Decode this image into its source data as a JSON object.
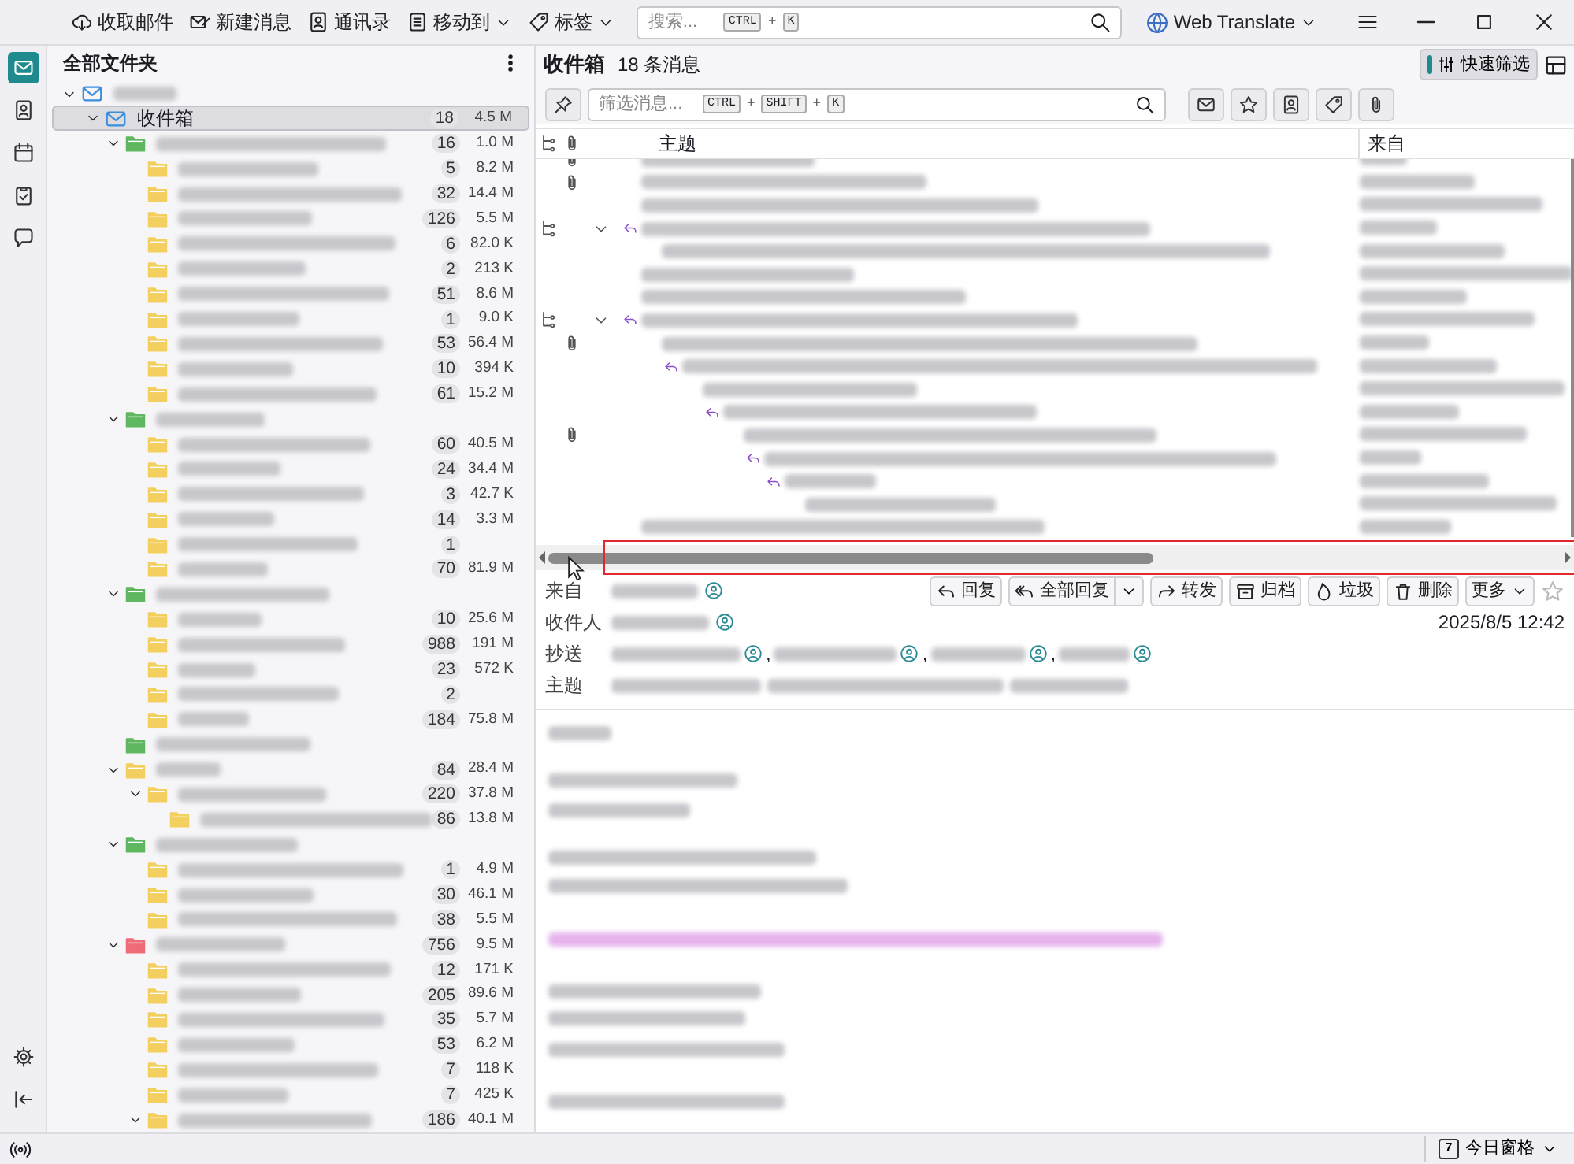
{
  "spaces": [
    {
      "kind": "mail",
      "selected": true
    },
    {
      "kind": "addressbook",
      "selected": false
    },
    {
      "kind": "calendar",
      "selected": false
    },
    {
      "kind": "tasks",
      "selected": false
    },
    {
      "kind": "chat",
      "selected": false
    }
  ],
  "spaces_bottom": [
    {
      "kind": "settings"
    },
    {
      "kind": "collapse"
    }
  ],
  "toolbar": [
    {
      "kind": "getmail",
      "label": "收取邮件",
      "dropdown": false
    },
    {
      "kind": "compose",
      "label": "新建消息",
      "dropdown": false
    },
    {
      "kind": "addressbook",
      "label": "通讯录",
      "dropdown": false
    },
    {
      "kind": "moveto",
      "label": "移动到",
      "dropdown": true
    },
    {
      "kind": "tag",
      "label": "标签",
      "dropdown": true
    }
  ],
  "search": {
    "placeholder": "搜索...",
    "shortcut": [
      {
        "key": "CTRL"
      },
      {
        "sep": "+"
      },
      {
        "key": "K"
      }
    ]
  },
  "translate": {
    "label": "Web Translate"
  },
  "folder_pane": {
    "title": "全部文件夹"
  },
  "folders": [
    {
      "kind": "account",
      "expanded": true,
      "selected": false,
      "children": [
        {
          "kind": "inbox",
          "label": "收件箱",
          "expanded": true,
          "selected": true,
          "unread": "18",
          "size": "4.5 M",
          "children": [
            {
              "kind": "folder",
              "color": "#5fb760",
              "expanded": true,
              "selected": false,
              "unread": "16",
              "size": "1.0 M",
              "children": [
                {
                  "kind": "folder",
                  "color": "#f3cf5f",
                  "selected": false,
                  "unread": "5",
                  "size": "8.2 M"
                },
                {
                  "kind": "folder",
                  "color": "#f3cf5f",
                  "selected": false,
                  "unread": "32",
                  "size": "14.4 M"
                },
                {
                  "kind": "folder",
                  "color": "#f3cf5f",
                  "selected": false,
                  "unread": "126",
                  "size": "5.5 M"
                },
                {
                  "kind": "folder",
                  "color": "#f3cf5f",
                  "selected": false,
                  "unread": "6",
                  "size": "82.0 K"
                },
                {
                  "kind": "folder",
                  "color": "#f3cf5f",
                  "selected": false,
                  "unread": "2",
                  "size": "213 K"
                },
                {
                  "kind": "folder",
                  "color": "#f3cf5f",
                  "selected": false,
                  "unread": "51",
                  "size": "8.6 M"
                },
                {
                  "kind": "folder",
                  "color": "#f3cf5f",
                  "selected": false,
                  "unread": "1",
                  "size": "9.0 K"
                },
                {
                  "kind": "folder",
                  "color": "#f3cf5f",
                  "selected": false,
                  "unread": "53",
                  "size": "56.4 M"
                },
                {
                  "kind": "folder",
                  "color": "#f3cf5f",
                  "selected": false,
                  "unread": "10",
                  "size": "394 K"
                },
                {
                  "kind": "folder",
                  "color": "#f3cf5f",
                  "selected": false,
                  "unread": "61",
                  "size": "15.2 M"
                }
              ]
            },
            {
              "kind": "folder",
              "color": "#5fb760",
              "expanded": true,
              "selected": false,
              "children": [
                {
                  "kind": "folder",
                  "color": "#f3cf5f",
                  "selected": false,
                  "unread": "60",
                  "size": "40.5 M"
                },
                {
                  "kind": "folder",
                  "color": "#f3cf5f",
                  "selected": false,
                  "unread": "24",
                  "size": "34.4 M"
                },
                {
                  "kind": "folder",
                  "color": "#f3cf5f",
                  "selected": false,
                  "unread": "3",
                  "size": "42.7 K"
                },
                {
                  "kind": "folder",
                  "color": "#f3cf5f",
                  "selected": false,
                  "unread": "14",
                  "size": "3.3 M"
                },
                {
                  "kind": "folder",
                  "color": "#f3cf5f",
                  "selected": false,
                  "unread": "1"
                },
                {
                  "kind": "folder",
                  "color": "#f3cf5f",
                  "selected": false,
                  "unread": "70",
                  "size": "81.9 M"
                }
              ]
            },
            {
              "kind": "folder",
              "color": "#5fb760",
              "expanded": true,
              "selected": false,
              "children": [
                {
                  "kind": "folder",
                  "color": "#f3cf5f",
                  "selected": false,
                  "unread": "10",
                  "size": "25.6 M"
                },
                {
                  "kind": "folder",
                  "color": "#f3cf5f",
                  "selected": false,
                  "unread": "988",
                  "size": "191 M"
                },
                {
                  "kind": "folder",
                  "color": "#f3cf5f",
                  "selected": false,
                  "unread": "23",
                  "size": "572 K"
                },
                {
                  "kind": "folder",
                  "color": "#f3cf5f",
                  "selected": false,
                  "unread": "2"
                },
                {
                  "kind": "folder",
                  "color": "#f3cf5f",
                  "selected": false,
                  "unread": "184",
                  "size": "75.8 M"
                }
              ]
            },
            {
              "kind": "folder",
              "color": "#5fb760",
              "selected": false
            },
            {
              "kind": "folder",
              "color": "#f3cf5f",
              "expanded": true,
              "selected": false,
              "unread": "84",
              "size": "28.4 M",
              "children": [
                {
                  "kind": "folder",
                  "color": "#f3cf5f",
                  "expanded": true,
                  "selected": false,
                  "unread": "220",
                  "size": "37.8 M",
                  "children": [
                    {
                      "kind": "folder",
                      "color": "#f3cf5f",
                      "selected": false,
                      "unread": "86",
                      "size": "13.8 M"
                    }
                  ]
                }
              ]
            },
            {
              "kind": "folder",
              "color": "#5fb760",
              "expanded": true,
              "selected": false,
              "children": [
                {
                  "kind": "folder",
                  "color": "#f3cf5f",
                  "selected": false,
                  "unread": "1",
                  "size": "4.9 M"
                },
                {
                  "kind": "folder",
                  "color": "#f3cf5f",
                  "selected": false,
                  "unread": "30",
                  "size": "46.1 M"
                },
                {
                  "kind": "folder",
                  "color": "#f3cf5f",
                  "selected": false,
                  "unread": "38",
                  "size": "5.5 M"
                }
              ]
            },
            {
              "kind": "folder",
              "color": "#ef6b78",
              "expanded": true,
              "selected": false,
              "unread": "756",
              "size": "9.5 M",
              "children": [
                {
                  "kind": "folder",
                  "color": "#f3cf5f",
                  "selected": false,
                  "unread": "12",
                  "size": "171 K"
                },
                {
                  "kind": "folder",
                  "color": "#f3cf5f",
                  "selected": false,
                  "unread": "205",
                  "size": "89.6 M"
                },
                {
                  "kind": "folder",
                  "color": "#f3cf5f",
                  "selected": false,
                  "unread": "35",
                  "size": "5.7 M"
                },
                {
                  "kind": "folder",
                  "color": "#f3cf5f",
                  "selected": false,
                  "unread": "53",
                  "size": "6.2 M"
                },
                {
                  "kind": "folder",
                  "color": "#f3cf5f",
                  "selected": false,
                  "unread": "7",
                  "size": "118 K"
                },
                {
                  "kind": "folder",
                  "color": "#f3cf5f",
                  "selected": false,
                  "unread": "7",
                  "size": "425 K"
                },
                {
                  "kind": "folder",
                  "color": "#f3cf5f",
                  "expanded": true,
                  "selected": false,
                  "unread": "186",
                  "size": "40.1 M"
                }
              ]
            }
          ]
        }
      ]
    }
  ],
  "list_header": {
    "title": "收件箱",
    "count": "18 条消息",
    "quick_filter": {
      "label": "快速筛选",
      "pressed": true
    }
  },
  "filter_bar": {
    "pin_pressed": false,
    "placeholder": "筛选消息...",
    "shortcut": [
      {
        "key": "CTRL"
      },
      {
        "sep": "+"
      },
      {
        "key": "SHIFT"
      },
      {
        "sep": "+"
      },
      {
        "key": "K"
      }
    ],
    "toggles": [
      {
        "kind": "unread",
        "pressed": false
      },
      {
        "kind": "starred",
        "pressed": false
      },
      {
        "kind": "contact",
        "pressed": false
      },
      {
        "kind": "tags",
        "pressed": false
      },
      {
        "kind": "attachment",
        "pressed": false
      }
    ]
  },
  "columns": [
    {
      "kind": "thread"
    },
    {
      "kind": "attachment"
    },
    {
      "kind": "text",
      "label": "主题"
    },
    {
      "kind": "text",
      "label": "来自"
    }
  ],
  "messages": [
    {
      "thread": false,
      "attachment": true,
      "replied": false
    },
    {
      "thread": false,
      "attachment": true,
      "replied": false
    },
    {
      "thread": false,
      "attachment": false,
      "replied": false
    },
    {
      "thread": true,
      "attachment": false,
      "replied": true,
      "expanded": true,
      "children": [
        {
          "thread": false,
          "attachment": false,
          "replied": false
        }
      ]
    },
    {
      "thread": false,
      "attachment": false,
      "replied": false
    },
    {
      "thread": false,
      "attachment": false,
      "replied": false
    },
    {
      "thread": true,
      "attachment": false,
      "replied": true,
      "expanded": true,
      "children": [
        {
          "thread": false,
          "attachment": true,
          "replied": false,
          "children": [
            {
              "thread": false,
              "attachment": false,
              "replied": true,
              "children": [
                {
                  "thread": false,
                  "attachment": false,
                  "replied": false,
                  "children": [
                    {
                      "thread": false,
                      "attachment": false,
                      "replied": true,
                      "children": [
                        {
                          "thread": false,
                          "attachment": true,
                          "replied": false,
                          "children": [
                            {
                              "thread": false,
                              "attachment": false,
                              "replied": true,
                              "children": [
                                {
                                  "thread": false,
                                  "attachment": false,
                                  "replied": true,
                                  "children": [
                                    {
                                      "thread": false,
                                      "attachment": false,
                                      "replied": false
                                    }
                                  ]
                                }
                              ]
                            }
                          ]
                        }
                      ]
                    }
                  ]
                }
              ]
            }
          ]
        }
      ]
    },
    {
      "thread": false,
      "attachment": false,
      "replied": false
    }
  ],
  "message_header": {
    "from_label": "来自",
    "to_label": "收件人",
    "cc_label": "抄送",
    "subject_label": "主题",
    "date": "2025/8/5 12:42",
    "cc_separators": [
      ",",
      ",",
      ","
    ],
    "starred": false,
    "actions": [
      {
        "kind": "reply",
        "label": "回复"
      },
      {
        "kind": "reply-all",
        "label": "全部回复",
        "dropdown": true
      },
      {
        "kind": "forward",
        "label": "转发"
      },
      {
        "kind": "archive",
        "label": "归档"
      },
      {
        "kind": "junk",
        "label": "垃圾"
      },
      {
        "kind": "delete",
        "label": "删除"
      },
      {
        "kind": "more",
        "label": "更多",
        "dropdown": true
      }
    ]
  },
  "status_bar": {
    "today_pane": {
      "label": "今日窗格",
      "day": "7"
    }
  }
}
